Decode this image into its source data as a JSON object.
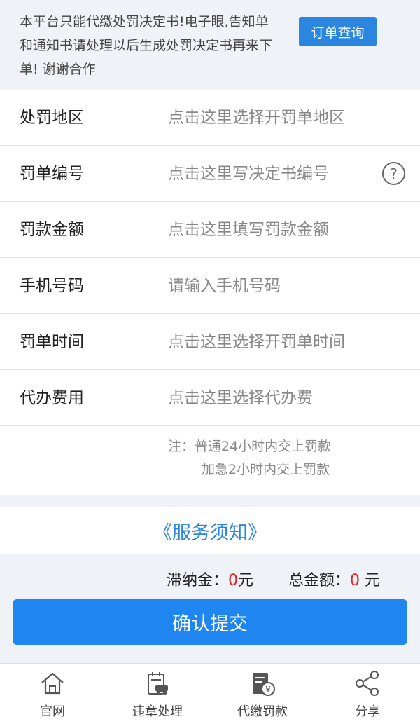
{
  "notice": {
    "text": "本平台只能代缴处罚决定书!电子眼,告知单和通知书请处理以后生成处罚决定书再来下单! 谢谢合作",
    "order_query_label": "订单查询"
  },
  "form": {
    "rows": [
      {
        "label": "处罚地区",
        "value": "点击这里选择开罚单地区"
      },
      {
        "label": "罚单编号",
        "value": "点击这里写决定书编号",
        "help": "?"
      },
      {
        "label": "罚款金额",
        "value": "点击这里填写罚款金额"
      },
      {
        "label": "手机号码",
        "value": "请输入手机号码"
      },
      {
        "label": "罚单时间",
        "value": "点击这里选择开罚单时间"
      },
      {
        "label": "代办费用",
        "value": "点击这里选择代办费"
      }
    ],
    "note_line1": "注：普通24小时内交上罚款",
    "note_line2": "加急2小时内交上罚款"
  },
  "service_link": "《服务须知》",
  "totals": {
    "late_fee_label": "滞纳金：",
    "late_fee_value": "0",
    "late_fee_unit": "元",
    "total_label": "总金额：",
    "total_value": "0",
    "total_unit": " 元"
  },
  "submit_label": "确认提交",
  "tabbar": {
    "tabs": [
      {
        "label": "官网",
        "icon": "home-icon"
      },
      {
        "label": "违章处理",
        "icon": "violation-icon"
      },
      {
        "label": "代缴罚款",
        "icon": "fine-payment-icon"
      },
      {
        "label": "分享",
        "icon": "share-icon"
      }
    ]
  },
  "colors": {
    "accent": "#2b86e0",
    "submit": "#1f85f0",
    "amount": "#e02020"
  }
}
